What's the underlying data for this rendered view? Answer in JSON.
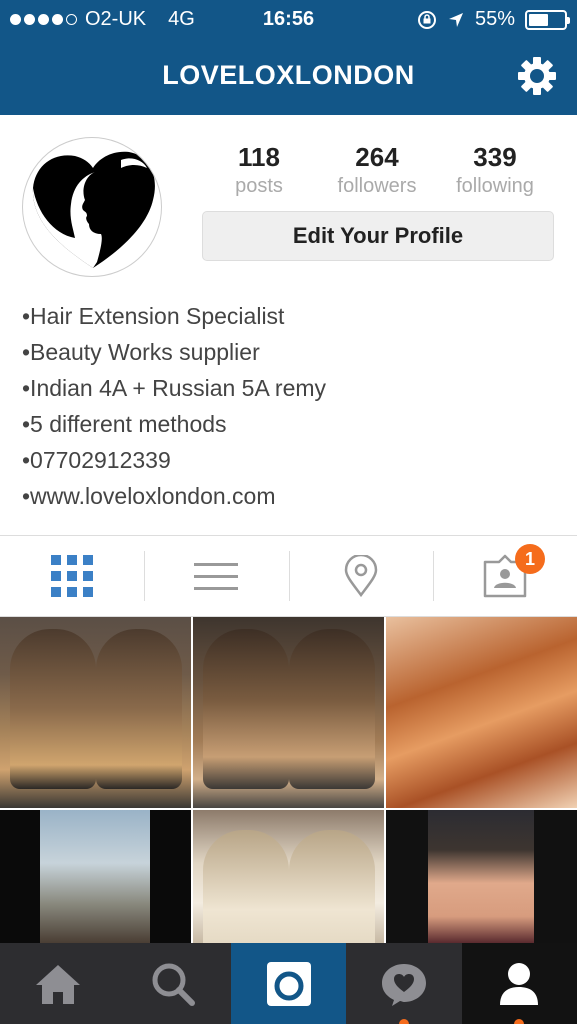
{
  "status_bar": {
    "carrier": "O2-UK",
    "network": "4G",
    "time": "16:56",
    "battery_percent": "55%",
    "battery_level": 0.55
  },
  "navbar": {
    "title": "LOVELOXLONDON"
  },
  "profile": {
    "stats": [
      {
        "count": "118",
        "label": "posts"
      },
      {
        "count": "264",
        "label": "followers"
      },
      {
        "count": "339",
        "label": "following"
      }
    ],
    "edit_button": "Edit Your Profile",
    "bio_lines": [
      "•Hair Extension Specialist",
      "•Beauty Works supplier",
      "•Indian 4A + Russian 5A remy",
      "•5 different methods",
      "•07702912339",
      "•www.loveloxlondon.com"
    ]
  },
  "view_tabs": {
    "tagged_badge": "1"
  },
  "colors": {
    "brand": "#125688",
    "accent_orange": "#f56c1c",
    "grid_blue": "#3b80c6"
  },
  "icons": [
    "signal-dots-icon",
    "location-arrow-icon",
    "orientation-lock-icon",
    "battery-icon",
    "gear-icon",
    "grid-icon",
    "list-icon",
    "map-pin-icon",
    "tagged-person-icon",
    "home-icon",
    "search-icon",
    "camera-icon",
    "activity-heart-icon",
    "profile-icon"
  ]
}
